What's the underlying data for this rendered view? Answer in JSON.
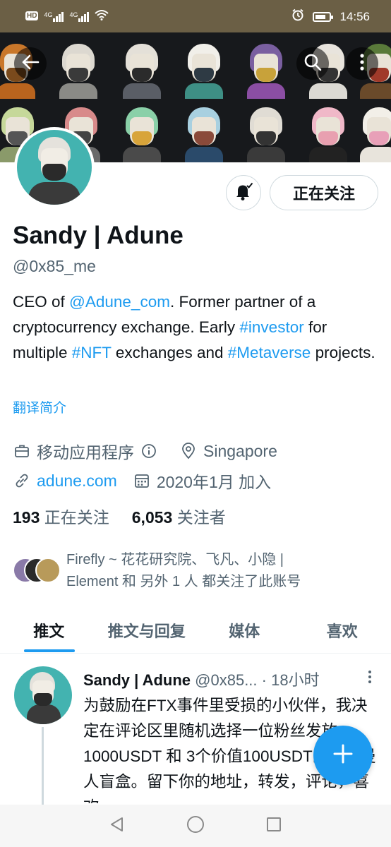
{
  "status_bar": {
    "hd_label": "HD",
    "network_1": "4G",
    "network_2": "4G",
    "time": "14:56"
  },
  "profile": {
    "display_name": "Sandy | Adune",
    "handle": "@0x85_me",
    "bio": {
      "p1": "CEO of ",
      "mention": "@Adune_com",
      "p2": ". Former partner of a cryptocurrency exchange. Early ",
      "tag1": "#investor",
      "p3": " for multiple ",
      "tag2": "#NFT",
      "p4": " exchanges and ",
      "tag3": "#Metaverse",
      "p5": " projects."
    },
    "translate_label": "翻译简介",
    "category": "移动应用程序",
    "location": "Singapore",
    "website": "adune.com",
    "joined": "2020年1月 加入",
    "following_count": "193",
    "following_label": "正在关注",
    "followers_count": "6,053",
    "followers_label": "关注者",
    "followed_by_line1": "Firefly ~ 花花研究院、飞凡、小隐 |",
    "followed_by_line2": "Element 和 另外 1 人 都关注了此账号",
    "follow_button_label": "正在关注"
  },
  "tabs": [
    {
      "label": "推文",
      "active": true
    },
    {
      "label": "推文与回复",
      "active": false
    },
    {
      "label": "媒体",
      "active": false
    },
    {
      "label": "喜欢",
      "active": false
    }
  ],
  "tweet": {
    "author_name": "Sandy | Adune",
    "author_handle": "@0x85...",
    "time": "· 18小时",
    "text": "为鼓励在FTX事件里受损的小伙伴，我决定在评论区里随机选择一位粉丝发放1000USDT 和 3个价值100USDT的弗里曼人盲盒。留下你的地址，转发，评论，喜欢"
  },
  "icons": {
    "back": "arrow-left-icon",
    "search": "search-icon",
    "more": "more-vertical-icon",
    "bell": "bell-notification-icon",
    "category": "briefcase-icon",
    "info": "info-icon",
    "location": "location-pin-icon",
    "link": "link-icon",
    "calendar": "calendar-icon",
    "compose": "plus-icon"
  },
  "colors": {
    "accent": "#1d9bf0",
    "text_primary": "#0f1419",
    "text_secondary": "#536471",
    "status_bar": "#6b5f45",
    "avatar_bg": "#43b3b0"
  }
}
